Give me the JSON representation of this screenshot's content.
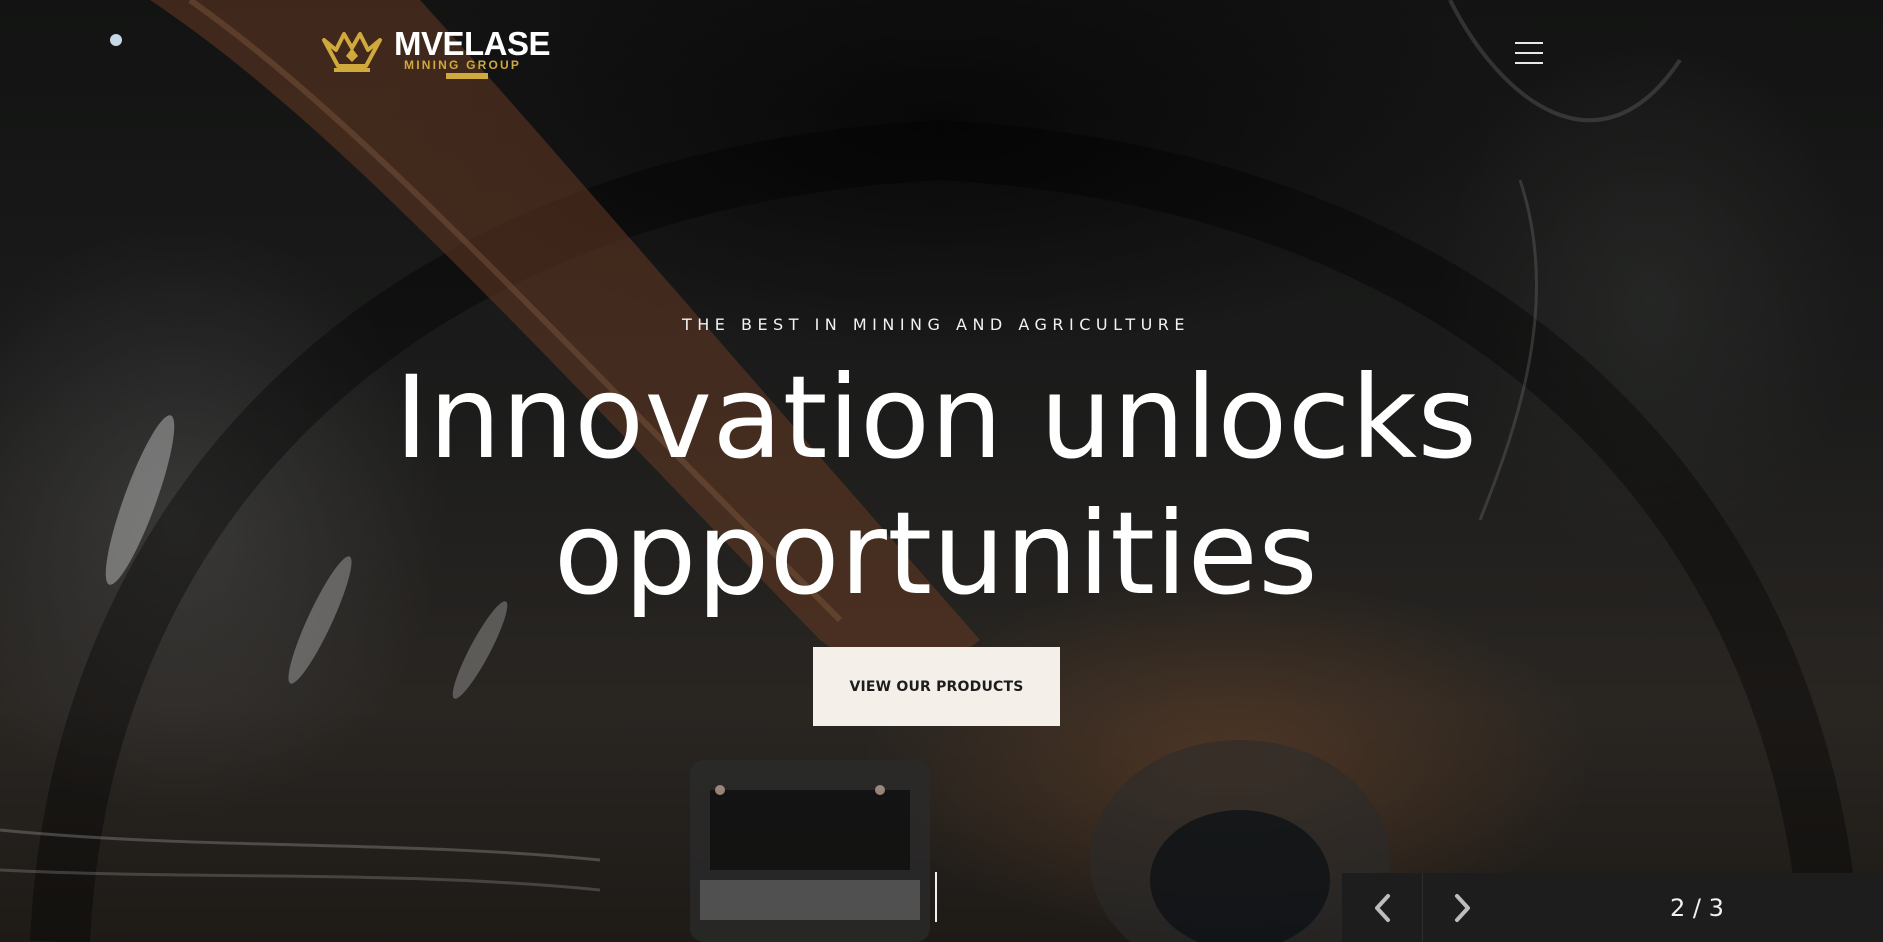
{
  "brand": {
    "name": "MVELASE",
    "tagline": "MINING GROUP",
    "icon": "crown-logo-icon",
    "accent_color": "#cfa93c"
  },
  "header": {
    "menu_icon": "hamburger-menu-icon"
  },
  "hero": {
    "kicker": "THE BEST IN MINING AND AGRICULTURE",
    "headline_line1": "Innovation unlocks",
    "headline_line2": "opportunities",
    "cta_label": "VIEW OUR PRODUCTS"
  },
  "slider": {
    "prev_icon": "chevron-left-icon",
    "next_icon": "chevron-right-icon",
    "counter": "2 / 3",
    "current": 2,
    "total": 3
  }
}
